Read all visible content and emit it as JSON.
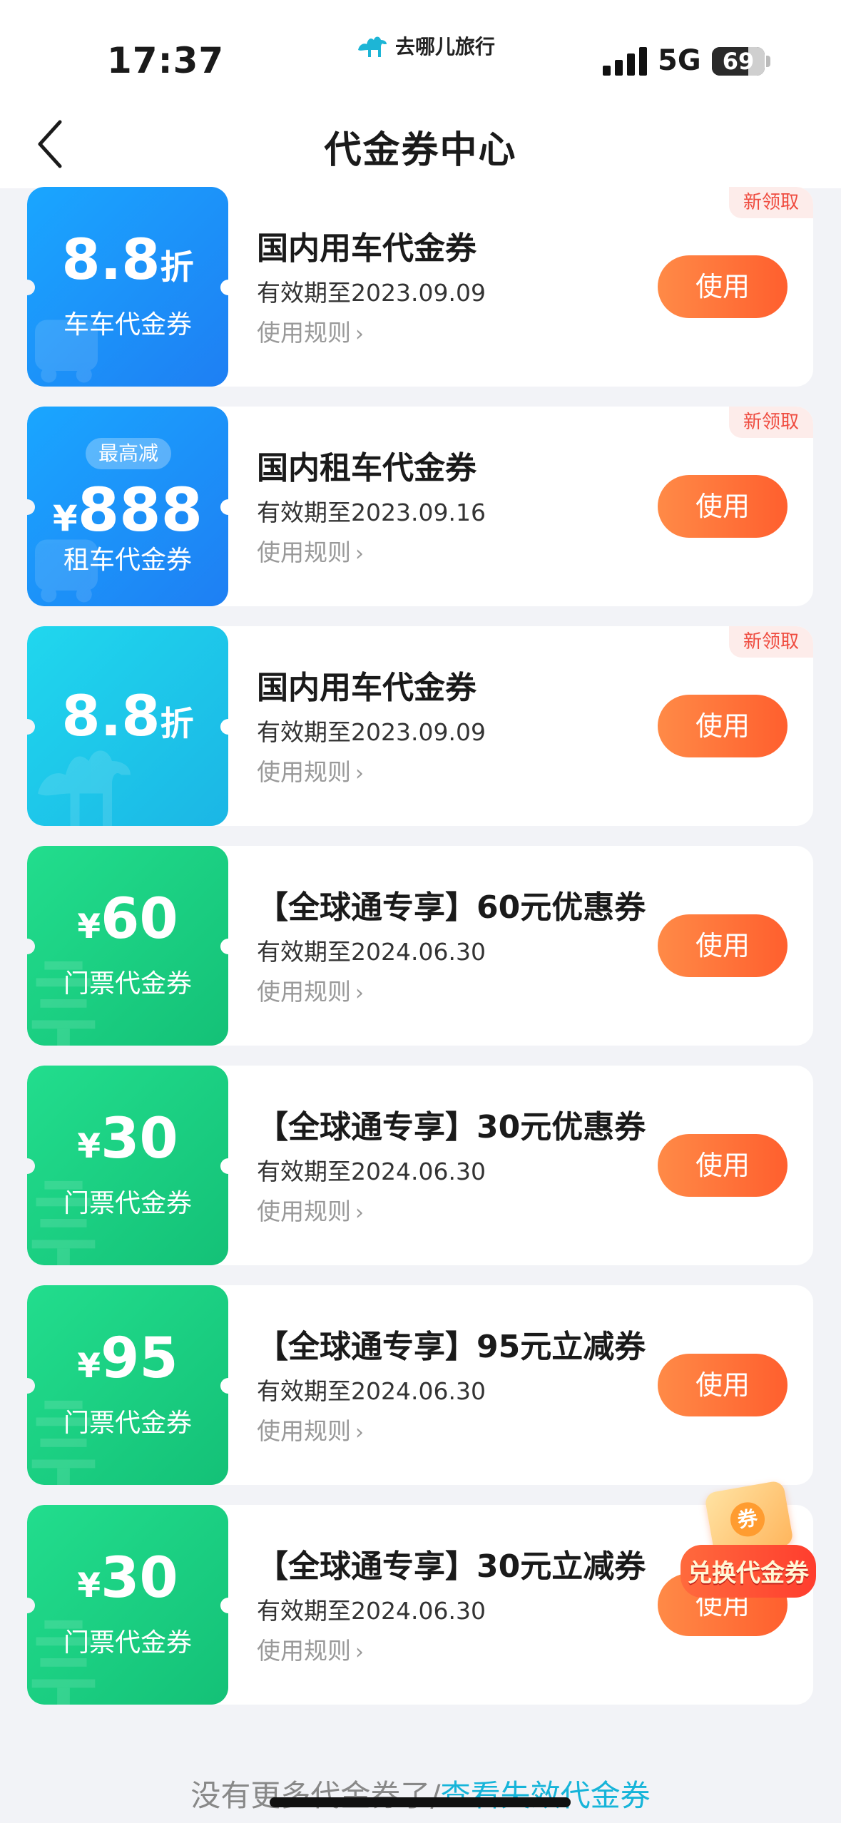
{
  "status_bar": {
    "time": "17:37",
    "brand": "去哪儿旅行",
    "network": "5G",
    "battery": "69",
    "battery_level": 0.69
  },
  "nav": {
    "title": "代金券中心"
  },
  "coupons": [
    {
      "theme": "blue",
      "pill": "",
      "big_prefix": "",
      "big_value": "8.8",
      "big_suffix": "折",
      "sub": "车车代金券",
      "title": "国内用车代金券",
      "valid": "有效期至2023.09.09",
      "rules": "使用规则",
      "button": "使用",
      "tag": "新领取"
    },
    {
      "theme": "blue",
      "pill": "最高减",
      "big_prefix": "¥",
      "big_value": "888",
      "big_suffix": "",
      "sub": "租车代金券",
      "title": "国内租车代金券",
      "valid": "有效期至2023.09.16",
      "rules": "使用规则",
      "button": "使用",
      "tag": "新领取"
    },
    {
      "theme": "cyan",
      "pill": "",
      "big_prefix": "",
      "big_value": "8.8",
      "big_suffix": "折",
      "sub": "",
      "title": "国内用车代金券",
      "valid": "有效期至2023.09.09",
      "rules": "使用规则",
      "button": "使用",
      "tag": "新领取"
    },
    {
      "theme": "green",
      "pill": "",
      "big_prefix": "¥",
      "big_value": "60",
      "big_suffix": "",
      "sub": "门票代金券",
      "title": "【全球通专享】60元优惠券",
      "valid": "有效期至2024.06.30",
      "rules": "使用规则",
      "button": "使用",
      "tag": ""
    },
    {
      "theme": "green",
      "pill": "",
      "big_prefix": "¥",
      "big_value": "30",
      "big_suffix": "",
      "sub": "门票代金券",
      "title": "【全球通专享】30元优惠券",
      "valid": "有效期至2024.06.30",
      "rules": "使用规则",
      "button": "使用",
      "tag": ""
    },
    {
      "theme": "green",
      "pill": "",
      "big_prefix": "¥",
      "big_value": "95",
      "big_suffix": "",
      "sub": "门票代金券",
      "title": "【全球通专享】95元立减券",
      "valid": "有效期至2024.06.30",
      "rules": "使用规则",
      "button": "使用",
      "tag": ""
    },
    {
      "theme": "green",
      "pill": "",
      "big_prefix": "¥",
      "big_value": "30",
      "big_suffix": "",
      "sub": "门票代金券",
      "title": "【全球通专享】30元立减券",
      "valid": "有效期至2024.06.30",
      "rules": "使用规则",
      "button": "使用",
      "tag": ""
    }
  ],
  "floating_badge": {
    "label": "兑换代金券",
    "coin": "券"
  },
  "footer": {
    "text": "没有更多代金券了/",
    "link": "查看失效代金券"
  },
  "colors": {
    "accent_orange": "#ff6a35",
    "blue": "#1e8ef5",
    "cyan": "#1cc6ea",
    "green": "#18cf80",
    "link": "#16b4d9"
  }
}
